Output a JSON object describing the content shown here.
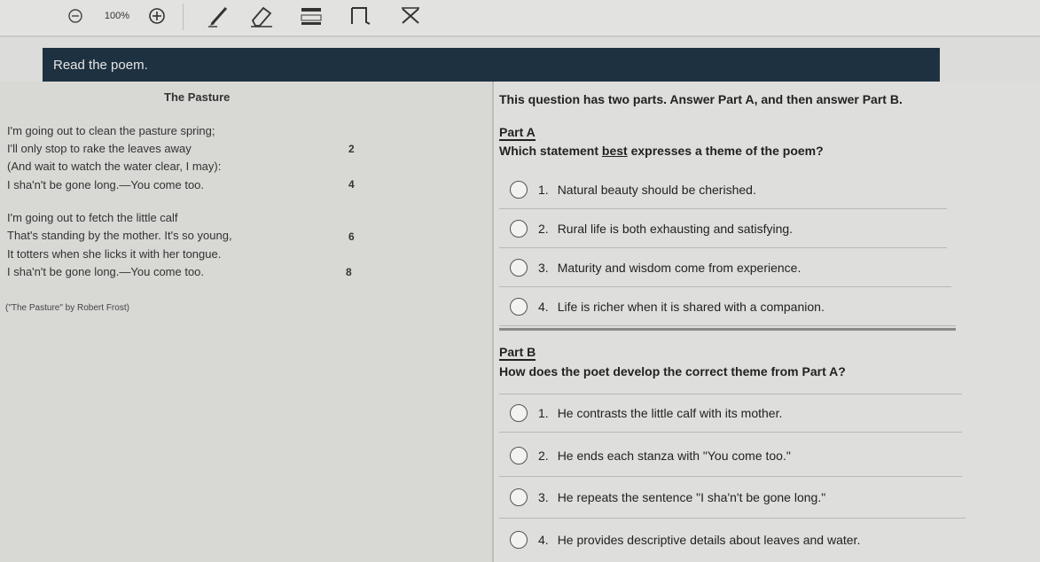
{
  "toolbar": {
    "zoom_label": "100%",
    "icons": [
      "zoom-out-icon",
      "zoom-in-icon",
      "pencil-icon",
      "eraser-icon",
      "answer-masking-icon",
      "flag-icon",
      "line-cross-icon"
    ]
  },
  "header": {
    "instruction": "Read the poem."
  },
  "poem": {
    "title": "The Pasture",
    "lines": [
      "I'm going out to clean the pasture spring;",
      "I'll only stop to rake the leaves away",
      "(And wait to watch the water clear, I may):",
      "I sha'n't be gone long.—You come too.",
      "I'm going out to fetch the little calf",
      "That's standing by the mother. It's so young,",
      "It totters when she licks it with her tongue.",
      "I sha'n't be gone long.—You come too."
    ],
    "line_numbers": [
      "2",
      "4",
      "6",
      "8"
    ],
    "citation": "(\"The Pasture\" by Robert Frost)"
  },
  "question": {
    "intro": "This question has two parts. Answer Part A, and then answer Part B.",
    "part_a": {
      "label": "Part A",
      "prompt_before": "Which statement ",
      "prompt_emphasis": "best",
      "prompt_after": " expresses a theme of the poem?",
      "options": [
        {
          "num": "1.",
          "text": "Natural beauty should be cherished."
        },
        {
          "num": "2.",
          "text": "Rural life is both exhausting and satisfying."
        },
        {
          "num": "3.",
          "text": "Maturity and wisdom come from experience."
        },
        {
          "num": "4.",
          "text": "Life is richer when it is shared with a companion."
        }
      ]
    },
    "part_b": {
      "label": "Part B",
      "prompt": "How does the poet develop the correct theme from Part A?",
      "options": [
        {
          "num": "1.",
          "text": "He contrasts the little calf with its mother."
        },
        {
          "num": "2.",
          "text": "He ends each stanza with \"You come too.\""
        },
        {
          "num": "3.",
          "text": "He repeats the sentence \"I sha'n't be gone long.\""
        },
        {
          "num": "4.",
          "text": "He provides descriptive details about leaves and water."
        }
      ]
    }
  },
  "colors": {
    "header_bg": "#1e3140",
    "header_text": "#e6e6e6",
    "page_bg": "#dededc"
  }
}
